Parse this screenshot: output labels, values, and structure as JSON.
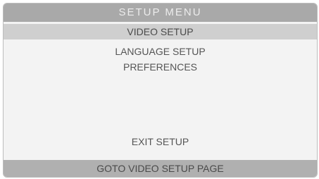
{
  "menu": {
    "title": "SETUP MENU",
    "items": [
      {
        "label": "VIDEO SETUP",
        "selected": true
      },
      {
        "label": "LANGUAGE SETUP",
        "selected": false
      },
      {
        "label": "PREFERENCES",
        "selected": false
      }
    ],
    "exit_label": "EXIT SETUP",
    "status_text": "GOTO VIDEO SETUP PAGE"
  }
}
